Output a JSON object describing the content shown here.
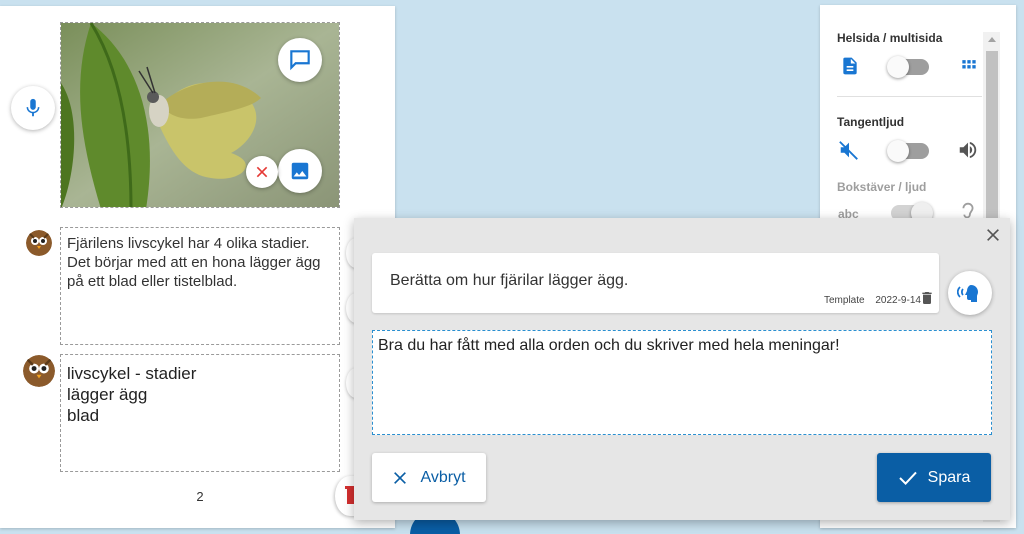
{
  "page": {
    "text_block_1": "Fjärilens livscykel har 4 olika stadier. Det börjar med att en hona lägger ägg på ett blad eller tistelblad.",
    "keywords": [
      "livscykel - stadier",
      "lägger ägg",
      "blad"
    ],
    "page_number": "2"
  },
  "settings": {
    "full_multi_label": "Helsida / multisida",
    "key_sound_label": "Tangentljud",
    "letters_sound_label": "Bokstäver / ljud",
    "letters_icon_text": "abc"
  },
  "dialog": {
    "prompt": "Berätta om hur fjärilar lägger ägg.",
    "prompt_tag": "Template",
    "prompt_date": "2022-9-14",
    "answer": "Bra du har fått med alla orden och du skriver med hela meningar!",
    "cancel_label": "Avbryt",
    "save_label": "Spara"
  },
  "colors": {
    "primary": "#0a5ea5",
    "icon_blue": "#1976d2",
    "danger": "#e53935",
    "background": "#c9e1ef"
  }
}
